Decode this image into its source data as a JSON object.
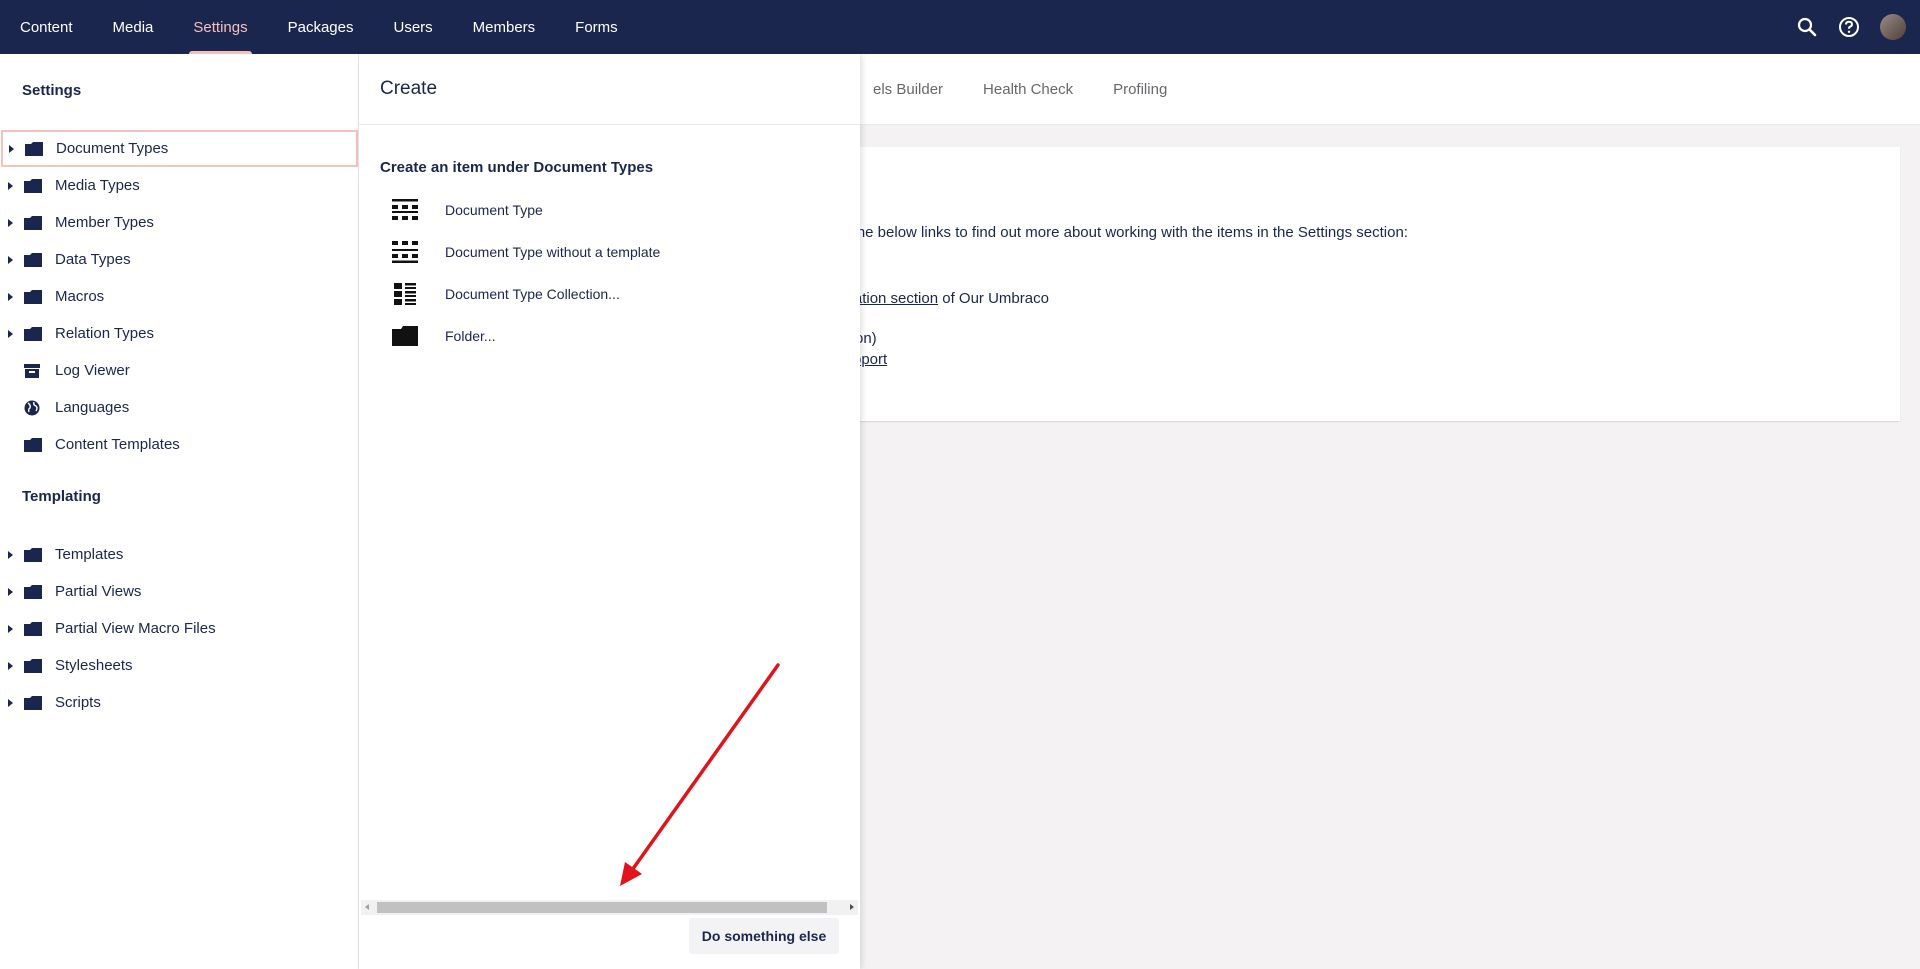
{
  "nav": {
    "items": [
      {
        "label": "Content"
      },
      {
        "label": "Media"
      },
      {
        "label": "Settings",
        "active": true
      },
      {
        "label": "Packages"
      },
      {
        "label": "Users"
      },
      {
        "label": "Members"
      },
      {
        "label": "Forms"
      }
    ],
    "icons": [
      "search-icon",
      "help-icon",
      "user-avatar"
    ]
  },
  "sidebar": {
    "settings_title": "Settings",
    "settings_items": [
      {
        "label": "Document Types",
        "icon": "folder-icon",
        "expandable": true,
        "selected": true
      },
      {
        "label": "Media Types",
        "icon": "folder-icon",
        "expandable": true
      },
      {
        "label": "Member Types",
        "icon": "folder-icon",
        "expandable": true
      },
      {
        "label": "Data Types",
        "icon": "folder-icon",
        "expandable": true
      },
      {
        "label": "Macros",
        "icon": "folder-icon",
        "expandable": true
      },
      {
        "label": "Relation Types",
        "icon": "folder-icon",
        "expandable": true
      },
      {
        "label": "Log Viewer",
        "icon": "archive-icon",
        "expandable": false
      },
      {
        "label": "Languages",
        "icon": "globe-icon",
        "expandable": false
      },
      {
        "label": "Content Templates",
        "icon": "folder-icon",
        "expandable": false
      }
    ],
    "templating_title": "Templating",
    "templating_items": [
      {
        "label": "Templates",
        "icon": "folder-icon",
        "expandable": true
      },
      {
        "label": "Partial Views",
        "icon": "folder-icon",
        "expandable": true
      },
      {
        "label": "Partial View Macro Files",
        "icon": "folder-icon",
        "expandable": true
      },
      {
        "label": "Stylesheets",
        "icon": "folder-icon",
        "expandable": true
      },
      {
        "label": "Scripts",
        "icon": "folder-icon",
        "expandable": true
      }
    ]
  },
  "main": {
    "tabs": [
      "els Builder",
      "Health Check",
      "Profiling"
    ],
    "card": {
      "line1": "v the below links to find out more about working with the items in the Settings section:",
      "line2_link": "entation section",
      "line2_rest": " of Our Umbraco",
      "line3": "on)",
      "line4_link": "pport"
    }
  },
  "create_panel": {
    "title": "Create",
    "subtitle": "Create an item under Document Types",
    "items": [
      {
        "label": "Document Type",
        "icon": "document-type-icon"
      },
      {
        "label": "Document Type without a template",
        "icon": "document-type-icon"
      },
      {
        "label": "Document Type Collection...",
        "icon": "collection-icon"
      },
      {
        "label": "Folder...",
        "icon": "folder-icon"
      }
    ],
    "secondary_button": "Do something else"
  },
  "colors": {
    "header_bg": "#1b264f",
    "accent": "#f5c1bc",
    "text": "#1b264f",
    "annotation_arrow": "#e0141a"
  }
}
